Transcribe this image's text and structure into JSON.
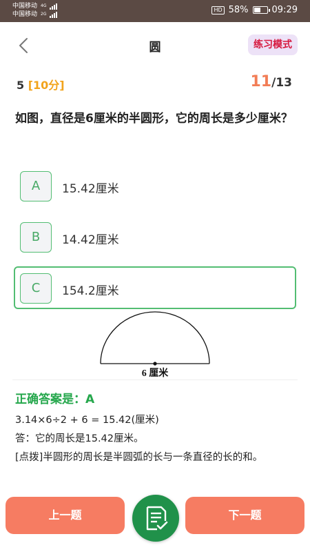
{
  "status_bar": {
    "carrier_1": "中国移动",
    "carrier_1_net": "4G",
    "carrier_2": "中国移动",
    "carrier_2_net": "2G",
    "hd": "HD",
    "battery_text": "58%",
    "battery_level": 0.58,
    "time": "09:29"
  },
  "header": {
    "back_icon": "chevron-left-icon",
    "title": "圆",
    "mode_label": "练习模式"
  },
  "question": {
    "number": "5",
    "score": "[10分]",
    "progress_current": "11",
    "progress_total": "/13",
    "text": "如图，直径是6厘米的半圆形，它的周长是多少厘米？"
  },
  "options": [
    {
      "letter": "A",
      "text": "15.42厘米",
      "selected": false
    },
    {
      "letter": "B",
      "text": "14.42厘米",
      "selected": false
    },
    {
      "letter": "C",
      "text": "154.2厘米",
      "selected": true
    }
  ],
  "figure": {
    "label": "6 厘米"
  },
  "answer": {
    "label": "正确答案是：A",
    "solution_lines": [
      "3.14×6÷2 + 6 = 15.42(厘米)",
      "答：它的周长是15.42厘米。",
      "[点拨]半圆形的周长是半圆弧的长与一条直径的长的和。"
    ]
  },
  "bottom_bar": {
    "prev_label": "上一题",
    "next_label": "下一题",
    "fab_icon": "answer-sheet-icon"
  },
  "colors": {
    "status_bar": "#5b4a44",
    "accent_green": "#52bd72",
    "answer_green": "#25a74c",
    "orange": "#f67c62",
    "score_orange": "#f2a31b",
    "badge_red": "#d6173d",
    "badge_bg": "#ede2f7",
    "fab_green": "#20914a"
  }
}
